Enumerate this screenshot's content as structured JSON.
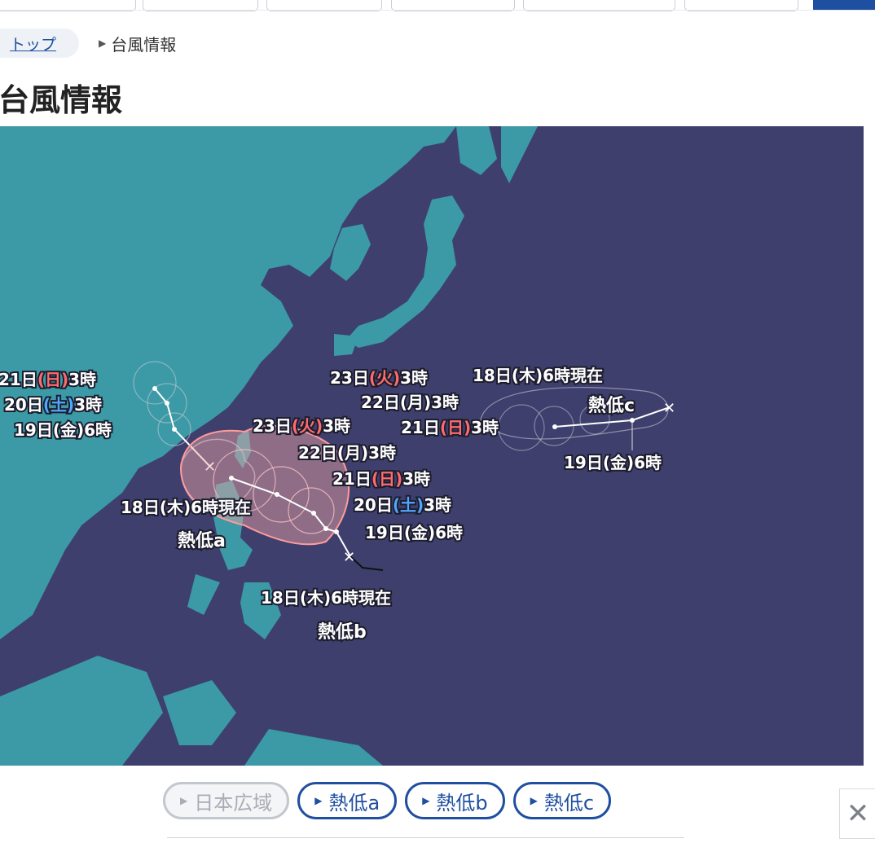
{
  "breadcrumb": {
    "home": "トップ",
    "current": "台風情報"
  },
  "page": {
    "title": "台風情報"
  },
  "map": {
    "colors": {
      "sea": "#3f3f6d",
      "land": "#3b9aa6",
      "forecast_area": "#f2a6a6"
    },
    "typhoons": {
      "a": {
        "name": "熱低a",
        "now": "18日(木)6時現在",
        "forecasts": [
          {
            "day": "19日",
            "weekday": "(金)",
            "time": "6時",
            "weekday_style": "normal"
          },
          {
            "day": "20日",
            "weekday": "(土)",
            "time": "3時",
            "weekday_style": "blue"
          },
          {
            "day": "21日",
            "weekday": "(日)",
            "time": "3時",
            "weekday_style": "red"
          }
        ]
      },
      "b": {
        "name": "熱低b",
        "now": "18日(木)6時現在",
        "forecasts": [
          {
            "day": "19日",
            "weekday": "(金)",
            "time": "6時",
            "weekday_style": "normal"
          },
          {
            "day": "20日",
            "weekday": "(土)",
            "time": "3時",
            "weekday_style": "blue"
          },
          {
            "day": "21日",
            "weekday": "(日)",
            "time": "3時",
            "weekday_style": "red"
          },
          {
            "day": "22日",
            "weekday": "(月)",
            "time": "3時",
            "weekday_style": "normal"
          },
          {
            "day": "23日",
            "weekday": "(火)",
            "time": "3時",
            "weekday_style": "red"
          }
        ]
      },
      "c": {
        "name": "熱低c",
        "now": "18日(木)6時現在",
        "forecasts": [
          {
            "day": "19日",
            "weekday": "(金)",
            "time": "6時",
            "weekday_style": "normal"
          },
          {
            "day": "21日",
            "weekday": "(日)",
            "time": "3時",
            "weekday_style": "red"
          },
          {
            "day": "22日",
            "weekday": "(月)",
            "time": "3時",
            "weekday_style": "normal"
          },
          {
            "day": "23日",
            "weekday": "(火)",
            "time": "3時",
            "weekday_style": "red"
          }
        ]
      }
    }
  },
  "selector": {
    "buttons": [
      {
        "label": "日本広域",
        "state": "disabled"
      },
      {
        "label": "熱低a",
        "state": "enabled"
      },
      {
        "label": "熱低b",
        "state": "enabled"
      },
      {
        "label": "熱低c",
        "state": "enabled"
      }
    ]
  },
  "close_label": "✕"
}
